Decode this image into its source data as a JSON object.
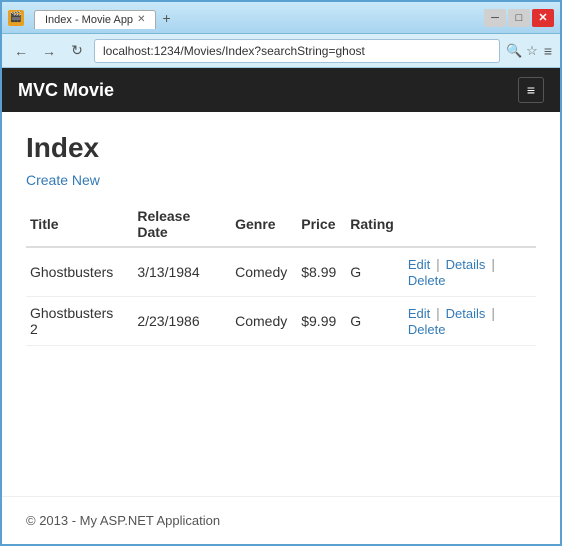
{
  "window": {
    "title": "Index - Movie App",
    "tab_label": "Index - Movie App",
    "close_btn": "✕",
    "min_btn": "─",
    "max_btn": "□"
  },
  "address_bar": {
    "url": "localhost:1234/Movies/Index?searchString=ghost",
    "back_btn": "←",
    "forward_btn": "→",
    "refresh_btn": "↻",
    "search_icon": "☆",
    "star_icon": "☆",
    "menu_icon": "≡"
  },
  "navbar": {
    "brand": "MVC Movie",
    "hamburger": "≡"
  },
  "page": {
    "title": "Index",
    "create_link": "Create New"
  },
  "table": {
    "headers": [
      "Title",
      "Release Date",
      "Genre",
      "Price",
      "Rating"
    ],
    "rows": [
      {
        "title": "Ghostbusters",
        "release_date": "3/13/1984",
        "genre": "Comedy",
        "price": "$8.99",
        "rating": "G"
      },
      {
        "title": "Ghostbusters 2",
        "release_date": "2/23/1986",
        "genre": "Comedy",
        "price": "$9.99",
        "rating": "G"
      }
    ],
    "actions": [
      "Edit",
      "Details",
      "Delete"
    ]
  },
  "footer": {
    "text": "© 2013 - My ASP.NET Application"
  }
}
